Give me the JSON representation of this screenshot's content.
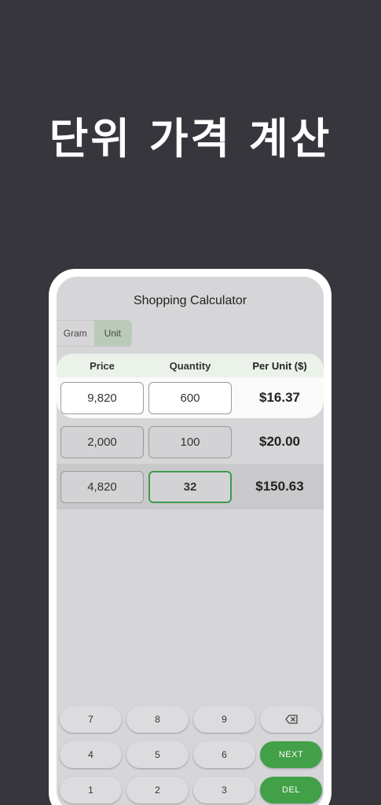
{
  "headline": "단위 가격 계산",
  "app": {
    "title": "Shopping Calculator",
    "modes": [
      {
        "label": "Gram",
        "active": false
      },
      {
        "label": "Unit",
        "active": true
      }
    ]
  },
  "table": {
    "headers": [
      "Price",
      "Quantity",
      "Per Unit ($)"
    ],
    "rows": [
      {
        "price": "9,820",
        "quantity": "600",
        "per_unit": "$16.37"
      },
      {
        "price": "2,000",
        "quantity": "100",
        "per_unit": "$20.00"
      },
      {
        "price": "4,820",
        "quantity": "32",
        "per_unit": "$150.63"
      }
    ]
  },
  "keypad": {
    "keys": [
      "7",
      "8",
      "9",
      "4",
      "5",
      "6",
      "1",
      "2",
      "3"
    ],
    "backspace_icon": "backspace-icon",
    "next_label": "NEXT",
    "del_label": "DEL"
  },
  "colors": {
    "background": "#38363d",
    "accent": "#42a049",
    "active_segment": "#b9cbb8",
    "header_bg": "#ebf2ea"
  }
}
